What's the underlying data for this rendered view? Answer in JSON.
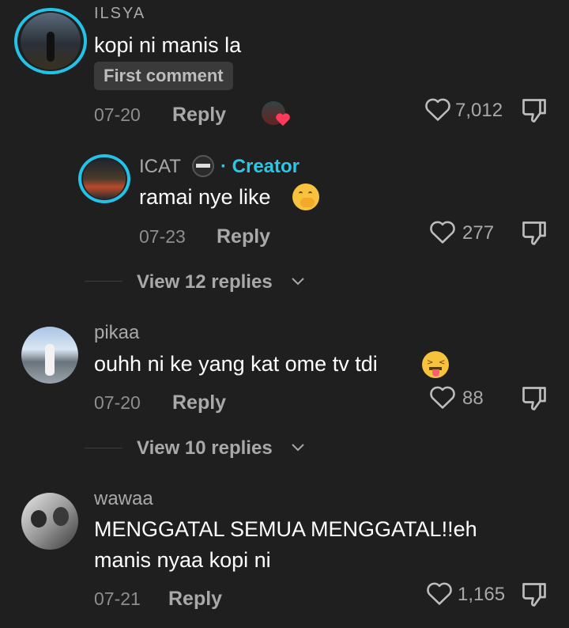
{
  "comments": [
    {
      "username": "ILSYA",
      "text": "kopi ni manis la",
      "badge": "First comment",
      "date": "07-20",
      "reply_label": "Reply",
      "likes": "7,012"
    },
    {
      "username": "ICAT",
      "creator_tag": "· Creator",
      "text": "ramai nye like",
      "date": "07-23",
      "reply_label": "Reply",
      "likes": "277"
    },
    {
      "username": "pikaa",
      "text": "ouhh ni ke yang kat ome tv tdi",
      "date": "07-20",
      "reply_label": "Reply",
      "likes": "88"
    },
    {
      "username": "wawaa",
      "text_line1": "MENGGATAL SEMUA MENGGATAL!!eh",
      "text_line2": "manis nyaa kopi ni",
      "date": "07-21",
      "reply_label": "Reply",
      "likes": "1,165"
    }
  ],
  "view_replies": [
    "View 12 replies",
    "View 10 replies"
  ],
  "chevron_glyph": "⌄",
  "colors": {
    "background": "#1f1f1f",
    "accent": "#22c3e6",
    "like_heart": "#ff3b5c"
  }
}
